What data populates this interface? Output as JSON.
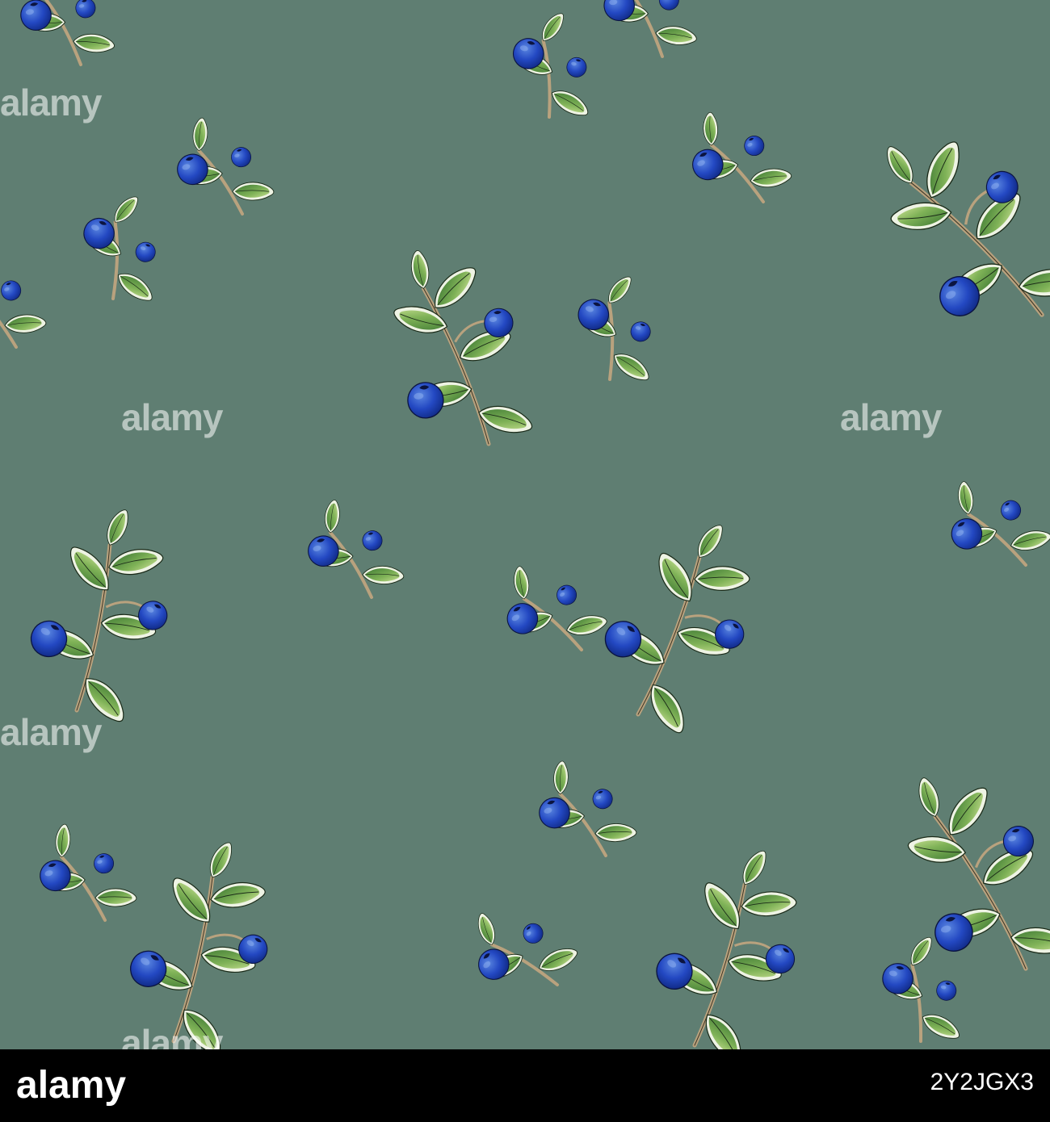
{
  "colors": {
    "background": "#5f7e72",
    "footer": "#000000",
    "stem": "#b9a27e",
    "leaf_dark": "#4f8a3e",
    "leaf_light": "#9fc56a",
    "leaf_edge": "#eef3e4",
    "berry": "#1f3fb5",
    "berry_light": "#4f78d6"
  },
  "icons": [
    "alamy-logo",
    "alamy-watermark"
  ],
  "watermark": {
    "text": "alamy"
  },
  "footer": {
    "image_id": "2Y2JGX3"
  }
}
